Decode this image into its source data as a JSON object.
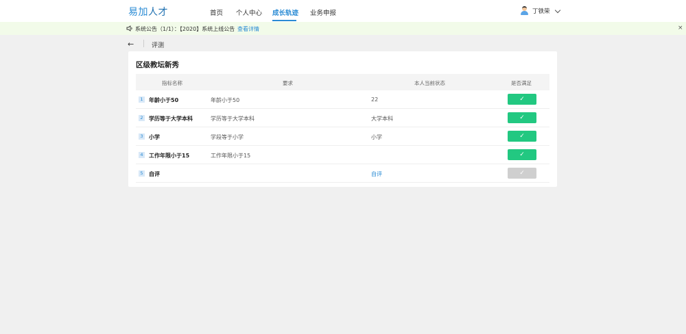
{
  "app": {
    "logo_part1": "易加",
    "logo_part2": "人才"
  },
  "nav": [
    {
      "label": "首页"
    },
    {
      "label": "个人中心"
    },
    {
      "label": "成长轨迹",
      "active": true
    },
    {
      "label": "业务申报"
    }
  ],
  "user": {
    "name": "丁铁荣",
    "avatar_icon": "avatar-icon"
  },
  "notice": {
    "text": "系统公告（1/1）：【2020】系统上线公告",
    "link": "查看详情",
    "close": "×",
    "bg_color": "#f2fbe9"
  },
  "breadcrumb": {
    "back": "←",
    "current": "评测"
  },
  "card": {
    "title": "区级教坛新秀",
    "columns": [
      "指标名称",
      "要求",
      "本人当前状态",
      "是否满足"
    ],
    "rows": [
      {
        "index": "1",
        "name": "年龄小于50",
        "requirement": "年龄小于50",
        "status": "22",
        "satisfied": true
      },
      {
        "index": "2",
        "name": "学历等于大学本科",
        "requirement": "学历等于大学本科",
        "status": "大学本科",
        "satisfied": true
      },
      {
        "index": "3",
        "name": "小学",
        "requirement": "学段等于小学",
        "status": "小学",
        "satisfied": true
      },
      {
        "index": "4",
        "name": "工作年限小于15",
        "requirement": "工作年限小于15",
        "status": "",
        "satisfied": true
      },
      {
        "index": "5",
        "name": "自评",
        "requirement": "",
        "status": "自评",
        "status_is_link": true,
        "satisfied": false
      }
    ],
    "check_mark": "✓"
  },
  "colors": {
    "accent": "#2a8bd4",
    "success": "#22c881",
    "disabled": "#cfcfcf"
  }
}
